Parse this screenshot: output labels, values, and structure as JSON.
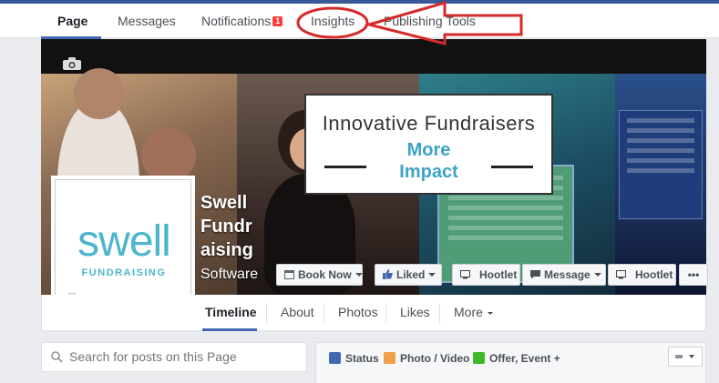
{
  "topnav": {
    "tabs": [
      {
        "label": "Page"
      },
      {
        "label": "Messages"
      },
      {
        "label": "Notifications"
      },
      {
        "label": "Insights"
      },
      {
        "label": "Publishing Tools"
      }
    ],
    "notification_count": "1"
  },
  "cover": {
    "headline": "Innovative Fundraisers",
    "subline1": "More",
    "subline2": "Impact"
  },
  "profile": {
    "logo_word": "swell",
    "logo_sub": "FUNDRAISING"
  },
  "page": {
    "name": "Swell Fundraising",
    "name_lines": [
      "Swell",
      "Fundr",
      "aising"
    ],
    "category": "Software"
  },
  "buttons": {
    "book_now": "Book Now",
    "liked": "Liked",
    "hootlet": "Hootlet",
    "message": "Message",
    "more": "•••"
  },
  "timeline_tabs": [
    "Timeline",
    "About",
    "Photos",
    "Likes",
    "More"
  ],
  "search": {
    "placeholder": "Search for posts on this Page"
  },
  "composer": {
    "status": "Status",
    "photo_video": "Photo / Video",
    "offer_event": "Offer, Event +"
  },
  "colors": {
    "brand_blue": "#4267b2",
    "annotation_red": "#d62a2a",
    "logo_teal": "#4db5cc",
    "badge_red": "#fa3e3e"
  },
  "icons": [
    "camera-icon",
    "search-icon",
    "calendar-icon",
    "thumbs-up-icon",
    "message-icon",
    "hootlet-icon",
    "pencil-icon",
    "photo-icon",
    "offer-icon",
    "audience-icon"
  ]
}
